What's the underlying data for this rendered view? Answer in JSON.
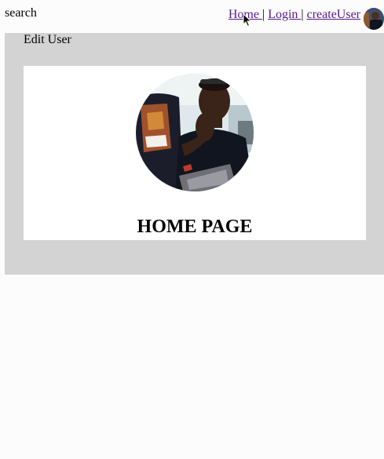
{
  "header": {
    "search_label": "search",
    "nav": [
      {
        "label": "Home "
      },
      {
        "label": "Login "
      },
      {
        "label": "createUser"
      }
    ],
    "separator": "|"
  },
  "panel": {
    "title": "Edit User",
    "heading": "HOME PAGE"
  },
  "colors": {
    "panel_bg": "#d3d3d3",
    "card_bg": "#ffffff",
    "link": "#551a8b"
  }
}
